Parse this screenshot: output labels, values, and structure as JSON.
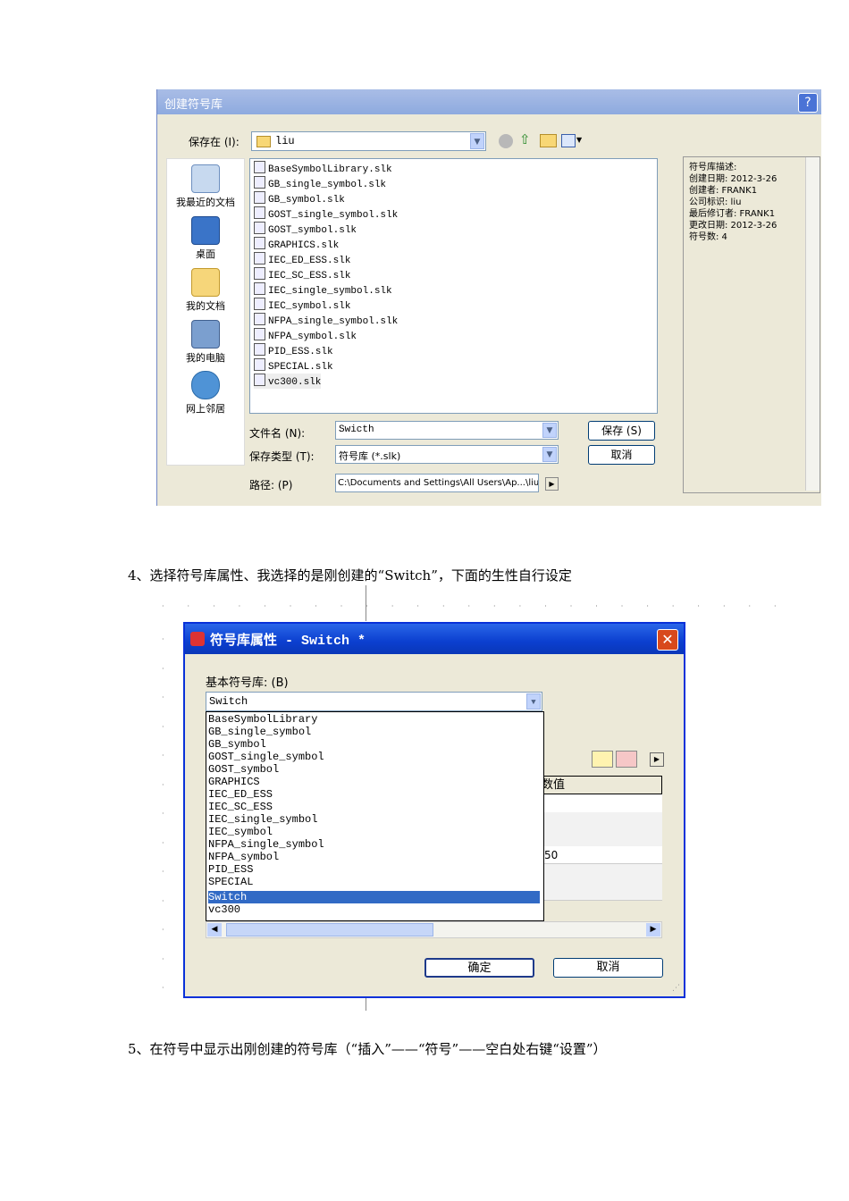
{
  "save_dialog": {
    "title": "创建符号库",
    "help": "?",
    "save_in_label": "保存在 (I):",
    "save_in_value": "liu",
    "places": [
      "我最近的文档",
      "桌面",
      "我的文档",
      "我的电脑",
      "网上邻居"
    ],
    "files": [
      "BaseSymbolLibrary.slk",
      "GB_single_symbol.slk",
      "GB_symbol.slk",
      "GOST_single_symbol.slk",
      "GOST_symbol.slk",
      "GRAPHICS.slk",
      "IEC_ED_ESS.slk",
      "IEC_SC_ESS.slk",
      "IEC_single_symbol.slk",
      "IEC_symbol.slk",
      "NFPA_single_symbol.slk",
      "NFPA_symbol.slk",
      "PID_ESS.slk",
      "SPECIAL.slk",
      "vc300.slk"
    ],
    "filename_label": "文件名 (N):",
    "filename_value": "Swicth",
    "filetype_label": "保存类型 (T):",
    "filetype_value": "符号库 (*.slk)",
    "path_label": "路径: (P)",
    "path_value": "C:\\Documents and Settings\\All Users\\Ap...\\liu",
    "save_button": "保存 (S)",
    "cancel_button": "取消",
    "description": [
      "符号库描述:",
      "创建日期: 2012-3-26",
      "创建者: FRANK1",
      "公司标识: liu",
      "最后修订者: FRANK1",
      "更改日期: 2012-3-26",
      "符号数: 4"
    ]
  },
  "step4": "4、选择符号库属性、我选择的是刚创建的“Switch”，下面的生性自行设定",
  "props_dialog": {
    "title": "符号库属性 - Switch *",
    "base_label": "基本符号库:  (B)",
    "base_value": "Switch",
    "options": [
      "BaseSymbolLibrary",
      "GB_single_symbol",
      "GB_symbol",
      "GOST_single_symbol",
      "GOST_symbol",
      "GRAPHICS",
      "IEC_ED_ESS",
      "IEC_SC_ESS",
      "IEC_single_symbol",
      "IEC_symbol",
      "NFPA_single_symbol",
      "NFPA_symbol",
      "PID_ESS",
      "SPECIAL",
      "Switch",
      "vc300"
    ],
    "selected_option": "Switch",
    "grid_header": "数值",
    "grid_value": "50",
    "ok_button": "确定",
    "cancel_button": "取消"
  },
  "step5": "5、在符号中显示出刚创建的符号库（“插入”——“符号”——空白处右键“设置”）"
}
